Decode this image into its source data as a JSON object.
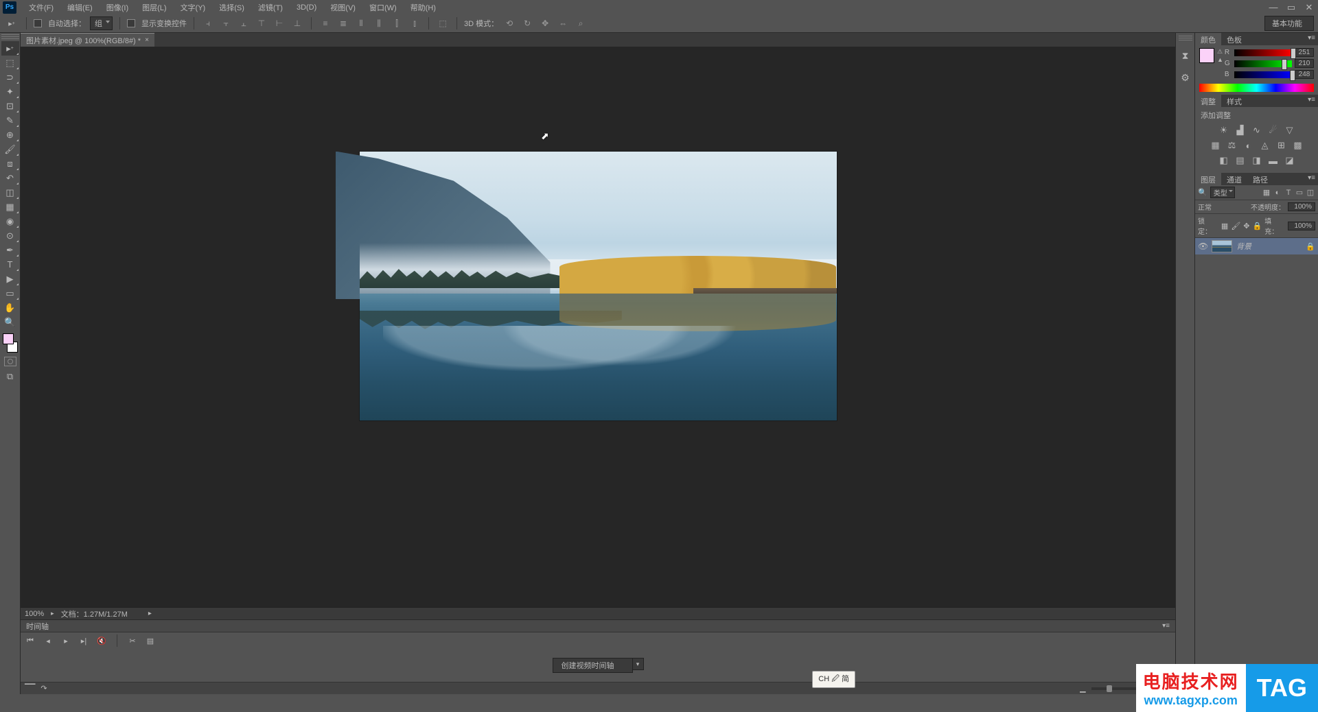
{
  "menubar": {
    "items": [
      "文件(F)",
      "编辑(E)",
      "图像(I)",
      "图层(L)",
      "文字(Y)",
      "选择(S)",
      "滤镜(T)",
      "3D(D)",
      "视图(V)",
      "窗口(W)",
      "帮助(H)"
    ]
  },
  "options": {
    "auto_select_label": "自动选择：",
    "auto_select_value": "组",
    "show_transform_label": "显示变换控件",
    "mode_3d_label": "3D 模式：",
    "workspace": "基本功能"
  },
  "document": {
    "tab_title": "图片素材.jpeg @ 100%(RGB/8#) *",
    "zoom": "100%",
    "doc_info": "文档：1.27M/1.27M"
  },
  "timeline": {
    "title": "时间轴",
    "create_btn": "创建视频时间轴"
  },
  "ime": "CH 🖉 简",
  "panels": {
    "color_tabs": [
      "颜色",
      "色板"
    ],
    "rgb": {
      "r": "251",
      "g": "210",
      "b": "248"
    },
    "adjust_tabs": [
      "调整",
      "样式"
    ],
    "adjust_title": "添加调整",
    "layers_tabs": [
      "图层",
      "通道",
      "路径"
    ],
    "layers": {
      "filter_label": "类型",
      "blend_mode": "正常",
      "opacity_label": "不透明度：",
      "opacity_value": "100%",
      "lock_label": "锁定：",
      "fill_label": "填充：",
      "fill_value": "100%",
      "items": [
        {
          "name": "背景"
        }
      ]
    }
  },
  "watermark": {
    "title": "电脑技术网",
    "url": "www.tagxp.com",
    "tag": "TAG"
  }
}
